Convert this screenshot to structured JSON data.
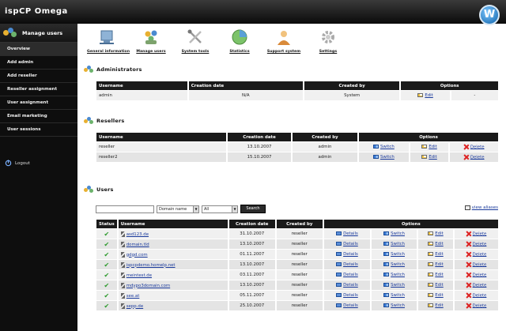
{
  "app": {
    "brand": "ispCP Omega",
    "logo_letter": "W"
  },
  "sidebar": {
    "title": "Manage users",
    "items": [
      {
        "label": "Overview",
        "active": true
      },
      {
        "label": "Add admin",
        "active": false
      },
      {
        "label": "Add reseller",
        "active": false
      },
      {
        "label": "Reseller assignment",
        "active": false
      },
      {
        "label": "User assignment",
        "active": false
      },
      {
        "label": "Email marketing",
        "active": false
      },
      {
        "label": "User sessions",
        "active": false
      }
    ],
    "logout": "Logout"
  },
  "topnav": [
    {
      "label": "General information",
      "icon": "general-information-icon"
    },
    {
      "label": "Manage users",
      "icon": "manage-users-icon"
    },
    {
      "label": "System tools",
      "icon": "system-tools-icon"
    },
    {
      "label": "Statistics",
      "icon": "statistics-icon"
    },
    {
      "label": "Support system",
      "icon": "support-system-icon"
    },
    {
      "label": "Settings",
      "icon": "settings-icon"
    }
  ],
  "administrators": {
    "title": "Administrators",
    "headers": [
      "Username",
      "Creation date",
      "Created by",
      "Options"
    ],
    "rows": [
      {
        "username": "admin",
        "created": "N/A",
        "by": "System",
        "edit": "Edit",
        "delete": "-"
      }
    ]
  },
  "resellers": {
    "title": "Resellers",
    "headers": [
      "Username",
      "Creation date",
      "Created by",
      "Options"
    ],
    "rows": [
      {
        "username": "reseller",
        "created": "13.10.2007",
        "by": "admin",
        "switch": "Switch",
        "edit": "Edit",
        "delete": "Delete"
      },
      {
        "username": "reseller2",
        "created": "15.10.2007",
        "by": "admin",
        "switch": "Switch",
        "edit": "Edit",
        "delete": "Delete"
      }
    ]
  },
  "users": {
    "title": "Users",
    "search_placeholder": "",
    "field_select": "Domain name",
    "status_select": "All",
    "search_button": "Search",
    "view_aliases": "view aliases",
    "headers": [
      "Status",
      "Username",
      "Creation date",
      "Created by",
      "Options"
    ],
    "rows": [
      {
        "username": "asd123.de",
        "created": "31.10.2007",
        "by": "reseller"
      },
      {
        "username": "domain.tld",
        "created": "13.10.2007",
        "by": "reseller"
      },
      {
        "username": "gdgd.com",
        "created": "01.11.2007",
        "by": "reseller"
      },
      {
        "username": "ispcpdemo.homelp.net",
        "created": "13.10.2007",
        "by": "reseller"
      },
      {
        "username": "meintest.de",
        "created": "03.11.2007",
        "by": "reseller"
      },
      {
        "username": "mdypo3domain.com",
        "created": "13.10.2007",
        "by": "reseller"
      },
      {
        "username": "see.at",
        "created": "05.11.2007",
        "by": "reseller"
      },
      {
        "username": "sepp.de",
        "created": "25.10.2007",
        "by": "reseller"
      }
    ],
    "details": "Details",
    "switch": "Switch",
    "edit": "Edit",
    "delete": "Delete"
  }
}
